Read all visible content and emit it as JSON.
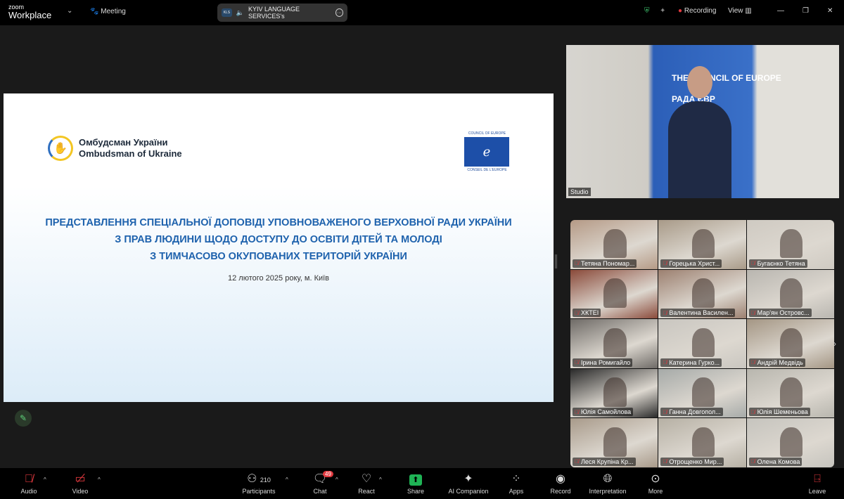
{
  "topbar": {
    "brand_small": "zoom",
    "brand": "Workplace",
    "meeting_label": "Meeting",
    "share_pill": "KYIV LANGUAGE SERVICES's",
    "recording": "Recording",
    "view": "View"
  },
  "slide": {
    "org_ua": "Омбудсман України",
    "org_en": "Ombudsman of Ukraine",
    "coe_top": "COUNCIL OF EUROPE",
    "coe_bottom": "CONSEIL DE L'EUROPE",
    "title": [
      "ПРЕДСТАВЛЕННЯ СПЕЦІАЛЬНОЇ ДОПОВІДІ УПОВНОВАЖЕНОГО ВЕРХОВНОЇ РАДИ УКРАЇНИ",
      "З ПРАВ ЛЮДИНИ ЩОДО ДОСТУПУ ДО ОСВІТИ ДІТЕЙ ТА МОЛОДІ",
      "З ТИМЧАСОВО ОКУПОВАНИХ ТЕРИТОРІЙ УКРАЇНИ"
    ],
    "date": "12 лютого 2025 року, м. Київ"
  },
  "speaker": {
    "name": "Studio",
    "banner": "THE COUNCIL OF EUROPE",
    "banner2": "РАДА ЄВР"
  },
  "participants": [
    {
      "name": "Тетяна Пономар...",
      "color": "#b59a86"
    },
    {
      "name": "Горецька Христ...",
      "color": "#a89a88"
    },
    {
      "name": "Бугаєнко Тетяна",
      "color": "#cfcac2"
    },
    {
      "name": "ХКТЕІ",
      "color": "#8a4a3a"
    },
    {
      "name": "Валентина Василен...",
      "color": "#9c8070"
    },
    {
      "name": "Мар'ян Островс...",
      "color": "#b9b6b0"
    },
    {
      "name": "Ірина Ромигайло",
      "color": "#6e6a66"
    },
    {
      "name": "Катерина Гурко...",
      "color": "#c9c6c0"
    },
    {
      "name": "Андрій Медвідь",
      "color": "#a49684"
    },
    {
      "name": "Юлія Самойлова",
      "color": "#2a2a2a"
    },
    {
      "name": "Ганна Довгопол...",
      "color": "#a6aaa8"
    },
    {
      "name": "Юлія Шеменьова",
      "color": "#b8b6ae"
    },
    {
      "name": "Леся Крупіна Кр...",
      "color": "#a89a8a"
    },
    {
      "name": "Отрощенко Мир...",
      "color": "#b6b0a4"
    },
    {
      "name": "Олена Комова",
      "color": "#c6c4be"
    }
  ],
  "toolbar": {
    "audio": "Audio",
    "video": "Video",
    "participants": "Participants",
    "participant_count": "210",
    "chat": "Chat",
    "chat_badge": "49",
    "react": "React",
    "share": "Share",
    "ai": "AI Companion",
    "apps": "Apps",
    "record": "Record",
    "interpretation": "Interpretation",
    "more": "More",
    "leave": "Leave"
  },
  "colors": {
    "slide_title": "#1e62ad",
    "share": "#1fb355",
    "leave": "#e0383e"
  }
}
